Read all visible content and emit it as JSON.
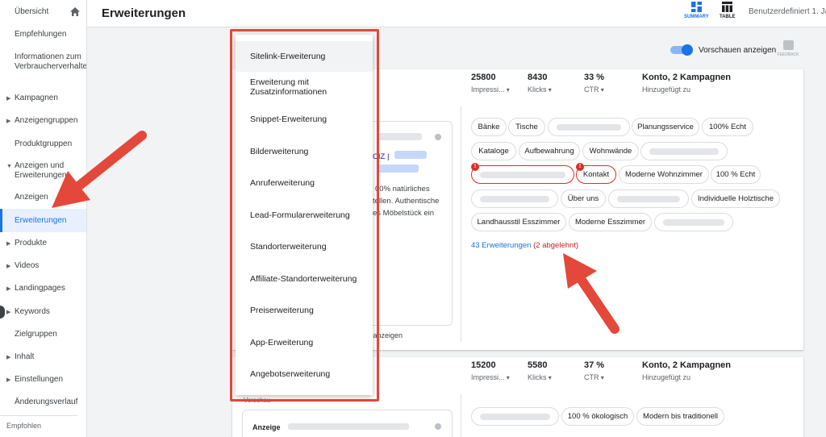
{
  "sidebar": {
    "items": [
      {
        "label": "Übersicht"
      },
      {
        "label": "Empfehlungen"
      },
      {
        "label": "Informationen zum Verbraucherverhalten"
      },
      {
        "label": "Kampagnen"
      },
      {
        "label": "Anzeigengruppen"
      },
      {
        "label": "Produktgruppen"
      },
      {
        "label": "Anzeigen und Erweiterungen"
      },
      {
        "label": "Anzeigen"
      },
      {
        "label": "Erweiterungen"
      },
      {
        "label": "Produkte"
      },
      {
        "label": "Videos"
      },
      {
        "label": "Landingpages"
      },
      {
        "label": "Keywords"
      },
      {
        "label": "Zielgruppen"
      },
      {
        "label": "Inhalt"
      },
      {
        "label": "Einstellungen"
      },
      {
        "label": "Änderungsverlauf"
      }
    ],
    "footer": "Empfohlen"
  },
  "header": {
    "title": "Erweiterungen",
    "summary_label": "SUMMARY",
    "table_label": "TABLE",
    "date_range": "Benutzerdefiniert  1. Ja",
    "accent": "#1a73e8"
  },
  "toolbar": {
    "preview_toggle_label": "Vorschauen anzeigen",
    "preview_toggle_on": true,
    "feedback_label": "FEEDBACK"
  },
  "card1": {
    "impressions": "25800",
    "impressions_label": "Impressi...",
    "clicks": "8430",
    "clicks_label": "Klicks",
    "ctr": "33 %",
    "ctr_label": "CTR",
    "scope": "Konto, 2 Kampagnen",
    "scope_label": "Hinzugefügt zu",
    "preview_lines": [
      "00% natürliches",
      "tellen. Authentische",
      "es Möbelstück ein"
    ],
    "preview_link_fragment": "CIZ |",
    "preview_footer": "e anzeigen",
    "preview_header_fragment": "w",
    "chips": [
      {
        "label": "Bänke"
      },
      {
        "label": "Tische"
      },
      {
        "label": ""
      },
      {
        "label": "Planungsservice"
      },
      {
        "label": "100% Echt"
      },
      {
        "label": "Kataloge"
      },
      {
        "label": "Aufbewahrung"
      },
      {
        "label": "Wohnwände"
      },
      {
        "label": ""
      },
      {
        "label": ""
      },
      {
        "label": "Kontakt"
      },
      {
        "label": "Moderne Wohnzimmer"
      },
      {
        "label": "100 % Echt"
      },
      {
        "label": ""
      },
      {
        "label": "Über uns"
      },
      {
        "label": ""
      },
      {
        "label": "Individuelle Holztische"
      },
      {
        "label": "Landhausstil Esszimmer"
      },
      {
        "label": "Moderne Esszimmer"
      },
      {
        "label": ""
      }
    ],
    "extensions_count": "43 Erweiterungen",
    "rejected": "(2 abgelehnt)"
  },
  "card2": {
    "impressions": "15200",
    "impressions_label": "Impressi...",
    "clicks": "5580",
    "clicks_label": "Klicks",
    "ctr": "37 %",
    "ctr_label": "CTR",
    "scope": "Konto, 2 Kampagnen",
    "scope_label": "Hinzugefügt zu",
    "preview_header_fragment": "Vorschau",
    "preview_ad_label": "Anzeige",
    "chips": [
      {
        "label": ""
      },
      {
        "label": "100 % ökologisch"
      },
      {
        "label": "Modern bis traditionell"
      }
    ]
  },
  "menu": {
    "items": [
      {
        "label": "Sitelink-Erweiterung"
      },
      {
        "label": "Erweiterung mit Zusatzinformationen"
      },
      {
        "label": "Snippet-Erweiterung"
      },
      {
        "label": "Bilderweiterung"
      },
      {
        "label": "Anruferweiterung"
      },
      {
        "label": "Lead-Formularerweiterung"
      },
      {
        "label": "Standorterweiterung"
      },
      {
        "label": "Affiliate-Standorterweiterung"
      },
      {
        "label": "Preiserweiterung"
      },
      {
        "label": "App-Erweiterung"
      },
      {
        "label": "Angebotserweiterung"
      }
    ],
    "highlight_color": "#e4483a"
  },
  "icons": {
    "home": "home-icon",
    "summary": "summary-grid-icon",
    "table": "table-icon",
    "feedback": "feedback-icon",
    "info": "info-icon",
    "error": "error-icon",
    "expand": "triangle-right-icon",
    "collapse": "triangle-down-icon",
    "annotation_arrow": "arrow-icon"
  }
}
